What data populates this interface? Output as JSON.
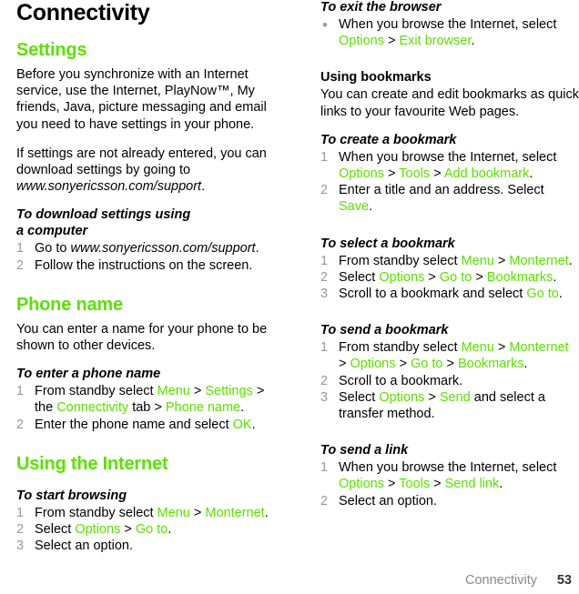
{
  "document": {
    "title": "Connectivity",
    "footer": {
      "chapter": "Connectivity",
      "page_number": "53"
    },
    "accent_color": "#5CE000",
    "number_color": "#9a9a9a",
    "footer_chapter_color": "#8a8a8a"
  },
  "left_column": {
    "section_settings": {
      "heading": "Settings",
      "para1": "Before you synchronize with an Internet service, use the Internet, PlayNow™, My friends, Java, picture messaging and email you need to have settings in your phone.",
      "para2_pre": "If settings are not already entered, you can download settings by going to ",
      "para2_url": "www.sonyericsson.com/support",
      "para2_post": ".",
      "procedure": {
        "heading_line1": "To download settings using",
        "heading_line2": "a computer",
        "steps": [
          {
            "num": "1",
            "pre": "Go to ",
            "url": "www.sonyericsson.com/support",
            "post": "."
          },
          {
            "num": "2",
            "pre": "Follow the instructions on the screen.",
            "url": "",
            "post": ""
          }
        ]
      }
    },
    "section_phone_name": {
      "heading": "Phone name",
      "para1": "You can enter a name for your phone to be shown to other devices.",
      "procedure": {
        "heading": "To enter a phone name",
        "step1": {
          "num": "1",
          "t1": "From standby select ",
          "g1": "Menu",
          "t2": " > ",
          "g2": "Settings",
          "t3": " > the ",
          "g3": "Connectivity",
          "t4": " tab > ",
          "g4": "Phone name",
          "t5": "."
        },
        "step2": {
          "num": "2",
          "t1": "Enter the phone name and select ",
          "g1": "OK",
          "t2": "."
        }
      }
    },
    "section_using_internet": {
      "heading": "Using the Internet",
      "procedure": {
        "heading": "To start browsing",
        "step1": {
          "num": "1",
          "t1": "From standby select ",
          "g1": "Menu",
          "t2": " > ",
          "g2": "Monternet",
          "t3": "."
        },
        "step2": {
          "num": "2",
          "t1": "Select ",
          "g1": "Options",
          "t2": " > ",
          "g2": "Go to",
          "t3": "."
        },
        "step3": {
          "num": "3",
          "t1": "Select an option."
        }
      }
    }
  },
  "right_column": {
    "proc_exit_browser": {
      "heading": "To exit the browser",
      "bullet_glyph": "•",
      "item": {
        "t1": "When you browse the Internet, select ",
        "g1": "Options",
        "t2": " > ",
        "g2": "Exit browser",
        "t3": "."
      }
    },
    "section_using_bookmarks": {
      "heading": "Using bookmarks",
      "para1": "You can create and edit bookmarks as quick links to your favourite Web pages."
    },
    "proc_create_bookmark": {
      "heading": "To create a bookmark",
      "step1": {
        "num": "1",
        "t1": "When you browse the Internet, select ",
        "g1": "Options",
        "t2": " > ",
        "g2": "Tools",
        "t3": " > ",
        "g3": "Add bookmark",
        "t4": "."
      },
      "step2": {
        "num": "2",
        "t1": "Enter a title and an address. Select ",
        "g1": "Save",
        "t2": "."
      }
    },
    "proc_select_bookmark": {
      "heading": "To select a bookmark",
      "step1": {
        "num": "1",
        "t1": "From standby select ",
        "g1": "Menu",
        "t2": " > ",
        "g2": "Monternet",
        "t3": "."
      },
      "step2": {
        "num": "2",
        "t1": "Select ",
        "g1": "Options",
        "t2": " > ",
        "g2": "Go to",
        "t3": " > ",
        "g3": "Bookmarks",
        "t4": "."
      },
      "step3": {
        "num": "3",
        "t1": "Scroll to a bookmark and select ",
        "g1": "Go to",
        "t2": "."
      }
    },
    "proc_send_bookmark": {
      "heading": "To send a bookmark",
      "step1": {
        "num": "1",
        "t1": "From standby select ",
        "g1": "Menu",
        "t2": " > ",
        "g2": "Monternet",
        "t3": " > ",
        "g3": "Options",
        "t4": " > ",
        "g4": "Go to",
        "t5": " > ",
        "g5": "Bookmarks",
        "t6": "."
      },
      "step2": {
        "num": "2",
        "t1": "Scroll to a bookmark."
      },
      "step3": {
        "num": "3",
        "t1": "Select ",
        "g1": "Options",
        "t2": " > ",
        "g2": "Send",
        "t3": " and select a transfer method."
      }
    },
    "proc_send_link": {
      "heading": "To send a link",
      "step1": {
        "num": "1",
        "t1": "When you browse the Internet, select ",
        "g1": "Options",
        "t2": " > ",
        "g2": "Tools",
        "t3": " > ",
        "g3": "Send link",
        "t4": "."
      },
      "step2": {
        "num": "2",
        "t1": "Select an option."
      }
    }
  }
}
